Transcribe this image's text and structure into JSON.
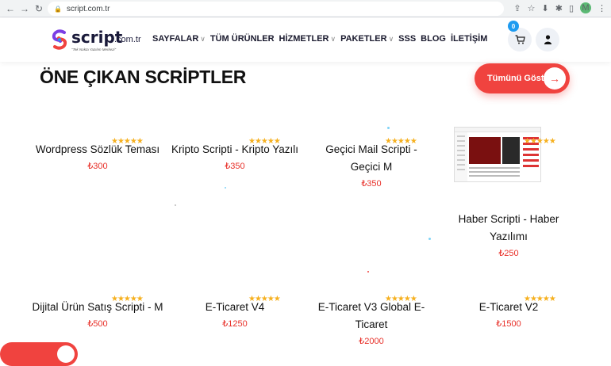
{
  "browser": {
    "url": "script.com.tr",
    "back_icon": "arrow-left-icon",
    "forward_icon": "arrow-right-icon",
    "reload_icon": "reload-icon",
    "profile_initial": "M"
  },
  "header": {
    "logo_text": "script",
    "logo_domain": ".com.tr",
    "logo_tagline": "\"Tek Nokta Yazılım Merkezi\"",
    "nav": [
      {
        "label": "SAYFALAR",
        "dropdown": true
      },
      {
        "label": "TÜM ÜRÜNLER",
        "dropdown": false
      },
      {
        "label": "HİZMETLER",
        "dropdown": true
      },
      {
        "label": "PAKETLER",
        "dropdown": true
      },
      {
        "label": "SSS",
        "dropdown": false
      },
      {
        "label": "BLOG",
        "dropdown": false
      },
      {
        "label": "İLETİŞİM",
        "dropdown": false
      }
    ],
    "cart_count": "0"
  },
  "section": {
    "title": "ÖNE ÇIKAN SCRİPTLER",
    "show_all_label": "Tümünü Göster"
  },
  "products": [
    {
      "name": "Wordpress Sözlük Teması",
      "price": "₺300",
      "rating": "★★★★★"
    },
    {
      "name": "Kripto Scripti - Kripto Yazılı",
      "price": "₺350",
      "rating": "★★★★★"
    },
    {
      "name": "Geçici Mail Scripti - Geçici M",
      "price": "₺350",
      "rating": "★★★★★"
    },
    {
      "name": "Haber Scripti - Haber Yazılımı",
      "price": "₺250",
      "rating": "★★★★★"
    },
    {
      "name": "Dijital Ürün Satış Scripti - M",
      "price": "₺500",
      "rating": "★★★★★"
    },
    {
      "name": "E-Ticaret V4",
      "price": "₺1250",
      "rating": "★★★★★"
    },
    {
      "name": "E-Ticaret V3 Global E-Ticaret",
      "price": "₺2000",
      "rating": "★★★★★"
    },
    {
      "name": "E-Ticaret V2",
      "price": "₺1500",
      "rating": "★★★★★"
    }
  ],
  "colors": {
    "accent": "#f0433f",
    "price": "#e8312a",
    "star": "#f6b01e",
    "badge": "#1e9bf0"
  }
}
